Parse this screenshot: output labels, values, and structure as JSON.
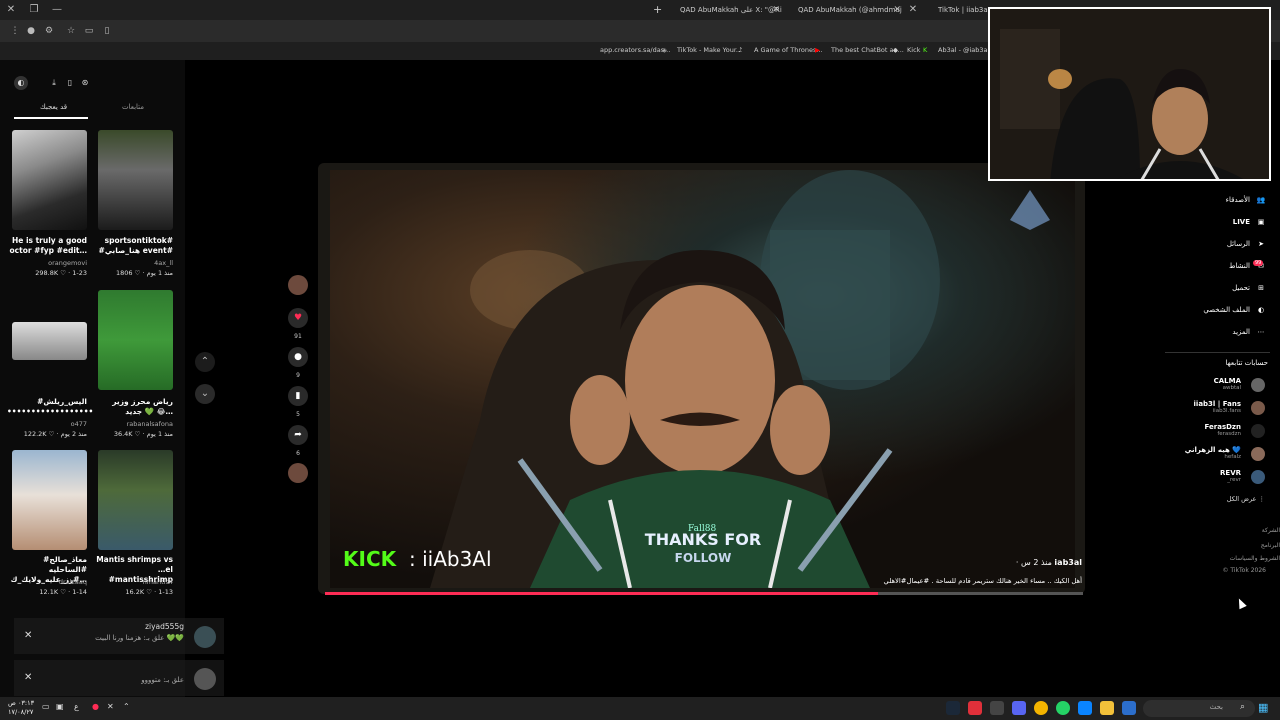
{
  "browser": {
    "tabs": [
      {
        "title": "QAD AbuMakkah على X: \"@Ri"
      },
      {
        "title": "QAD AbuMakkah (@ahmdmuj"
      },
      {
        "title": "TikTok | iiab3al | K"
      }
    ],
    "bookmarks": [
      "app.creators.sa/das...",
      "TikTok - Make Your...",
      "A Game of Thrones...",
      "The best ChatBot an...",
      "Kick",
      "Ab3al - @iab3al | C"
    ]
  },
  "left_sidebar": {
    "tabs": [
      "قد يعجبك",
      "متابعات"
    ],
    "cards": [
      {
        "title": "He is truly a good octor #fyp #edit…",
        "user": "orangemovi",
        "likes": "298.8K",
        "date": "1-23"
      },
      {
        "title": "sportsontiktok# #هنا_صابي event#",
        "user": "4ax_ll",
        "likes": "1806",
        "date": "منذ 1 يوم"
      },
      {
        "title": "#اليس_ريلش ••••••••••••••••••",
        "user": "o477",
        "likes": "122.2K",
        "date": "منذ 2 يوم"
      },
      {
        "title": "رياض محرز وزير جديد 💚 😂…",
        "user": "rabanalsafona",
        "likes": "36.4K",
        "date": "منذ 1 يوم"
      },
      {
        "title": "#معاذ_صالح #الساحليه #رز_عليه_ولايك_ك…",
        "user": "dralzaaq",
        "likes": "12.1K",
        "date": "1-14"
      },
      {
        "title": "Mantis shrimps vs …el #mantisshrimp",
        "user": "nmantis4",
        "likes": "16.2K",
        "date": "1-13"
      }
    ],
    "popups": [
      {
        "name": "ziyad555g",
        "text": "علق بـ: هزمنا ورنا البيت 💚💚"
      },
      {
        "name": "",
        "text": "علق بـ: متوووو"
      }
    ]
  },
  "stream": {
    "kick_label": "KICK",
    "kick_user": ": iiAb3Al",
    "alert_name": "Fall88",
    "alert_line1": "THANKS FOR",
    "alert_line2": "FOLLOW",
    "overlay_user": "iab3al",
    "overlay_time": "· منذ 2 س",
    "overlay_caption": "أهل الكيك .. مساء الخير هنالك ستريمر قادم للساحة . #عيمال#الاهلي",
    "progress": 0.73,
    "actions": {
      "likes": "91",
      "comments": "9",
      "saves": "5",
      "shares": "6"
    }
  },
  "right_sidebar": {
    "nav": [
      {
        "label": "الأصدقاء",
        "icon": "friends-icon"
      },
      {
        "label": "LIVE",
        "icon": "live-icon"
      },
      {
        "label": "الرسائل",
        "icon": "messages-icon"
      },
      {
        "label": "النشاط",
        "icon": "activity-icon",
        "badge": "99"
      },
      {
        "label": "تحميل",
        "icon": "upload-icon"
      },
      {
        "label": "الملف الشخصي",
        "icon": "profile-icon"
      },
      {
        "label": "المزيد",
        "icon": "more-icon"
      }
    ],
    "following_header": "حسابات تتابعها",
    "following": [
      {
        "name": "CALMA",
        "handle": "awbtal"
      },
      {
        "name": "iiab3l | Fans",
        "handle": "iiab3l.fans"
      },
      {
        "name": "FerasDzn",
        "handle": "ferasdzn"
      },
      {
        "name": "هيه الزهراني 💙",
        "handle": "hefalz"
      },
      {
        "name": "REVR",
        "handle": "_revr"
      }
    ],
    "show_all": "عرض الكل",
    "footer": [
      "الشركة",
      "البرنامج",
      "الشروط والسياسات",
      "© TikTok 2026"
    ]
  },
  "taskbar": {
    "time": "٠٣:١٣ ص",
    "date": "١٧/٠٨/٢٧",
    "search_placeholder": "بحث",
    "lang": "ع"
  },
  "colors": {
    "accent": "#fe2c55",
    "kick_green": "#53fc18"
  }
}
